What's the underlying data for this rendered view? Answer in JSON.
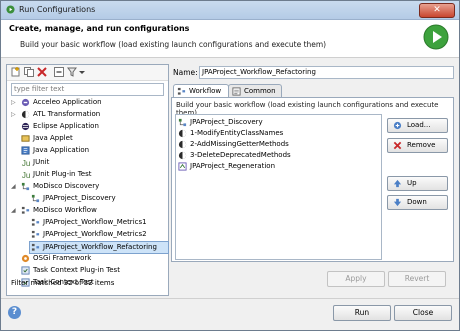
{
  "window": {
    "title": "Run Configurations"
  },
  "banner": {
    "heading": "Create, manage, and run configurations",
    "subheading": "Build your basic workflow (load existing launch configurations and execute them)"
  },
  "filter": {
    "placeholder": "type filter text"
  },
  "tree": [
    {
      "label": "Acceleo Application",
      "icon": "acceleo-icon",
      "expander": "▷"
    },
    {
      "label": "ATL Transformation",
      "icon": "atl-icon",
      "expander": "▷"
    },
    {
      "label": "Eclipse Application",
      "icon": "eclipse-icon",
      "expander": ""
    },
    {
      "label": "Java Applet",
      "icon": "java-applet-icon",
      "expander": ""
    },
    {
      "label": "Java Application",
      "icon": "java-app-icon",
      "expander": ""
    },
    {
      "label": "JUnit",
      "icon": "junit-icon",
      "expander": ""
    },
    {
      "label": "JUnit Plug-in Test",
      "icon": "junit-plugin-icon",
      "expander": ""
    },
    {
      "label": "MoDisco Discovery",
      "icon": "modisco-discovery-icon",
      "expander": "◢"
    },
    {
      "label": "JPAProject_Discovery",
      "icon": "discovery-config-icon",
      "expander": ""
    },
    {
      "label": "MoDisco Workflow",
      "icon": "modisco-workflow-icon",
      "expander": "◢"
    },
    {
      "label": "JPAProject_Workflow_Metrics1",
      "icon": "workflow-config-icon",
      "expander": ""
    },
    {
      "label": "JPAProject_Workflow_Metrics2",
      "icon": "workflow-config-icon",
      "expander": ""
    },
    {
      "label": "JPAProject_Workflow_Refactoring",
      "icon": "workflow-config-icon",
      "expander": ""
    },
    {
      "label": "OSGi Framework",
      "icon": "osgi-icon",
      "expander": ""
    },
    {
      "label": "Task Context Plug-in Test",
      "icon": "task-context-icon",
      "expander": ""
    },
    {
      "label": "Task Context Test",
      "icon": "task-context-icon",
      "expander": ""
    }
  ],
  "status": "Filter matched 32 of 32 items",
  "name": {
    "label": "Name:",
    "value": "JPAProject_Workflow_Refactoring"
  },
  "tabs": [
    {
      "label": "Workflow",
      "icon": "workflow-tab-icon"
    },
    {
      "label": "Common",
      "icon": "common-tab-icon"
    }
  ],
  "workflow_caption": "Build your basic workflow (load existing launch configurations and execute them)",
  "workflow_items": [
    {
      "label": "JPAProject_Discovery",
      "icon": "discovery-config-icon"
    },
    {
      "label": "1-ModifyEntityClassNames",
      "icon": "atl-icon"
    },
    {
      "label": "2-AddMissingGetterMethods",
      "icon": "atl-icon"
    },
    {
      "label": "3-DeleteDeprecatedMethods",
      "icon": "atl-icon"
    },
    {
      "label": "JPAProject_Regeneration",
      "icon": "acceleo-icon"
    }
  ],
  "side_buttons": {
    "load": "Load...",
    "remove": "Remove",
    "up": "Up",
    "down": "Down"
  },
  "actions": {
    "apply": "Apply",
    "revert": "Revert",
    "run": "Run",
    "close": "Close"
  },
  "colors": {
    "accent": "#cde3f8",
    "run_green": "#3da23d"
  }
}
